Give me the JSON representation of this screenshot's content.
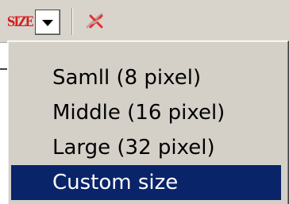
{
  "toolbar": {
    "size_button_label": "SIZE",
    "size_button_icon": "size-text-icon",
    "dropdown_icon": "chevron-down-icon",
    "disabled_tool_icon": "crossed-line-icon"
  },
  "menu": {
    "items": [
      {
        "label": "Samll (8 pixel)",
        "selected": false
      },
      {
        "label": "Middle (16 pixel)",
        "selected": false
      },
      {
        "label": "Large (32 pixel)",
        "selected": false
      },
      {
        "label": "Custom size",
        "selected": true
      }
    ]
  },
  "colors": {
    "toolbar_bg": "#d8d4cc",
    "menu_bg": "#d4d0c8",
    "selection_bg": "#0a246a",
    "size_icon_red": "#d42020"
  }
}
